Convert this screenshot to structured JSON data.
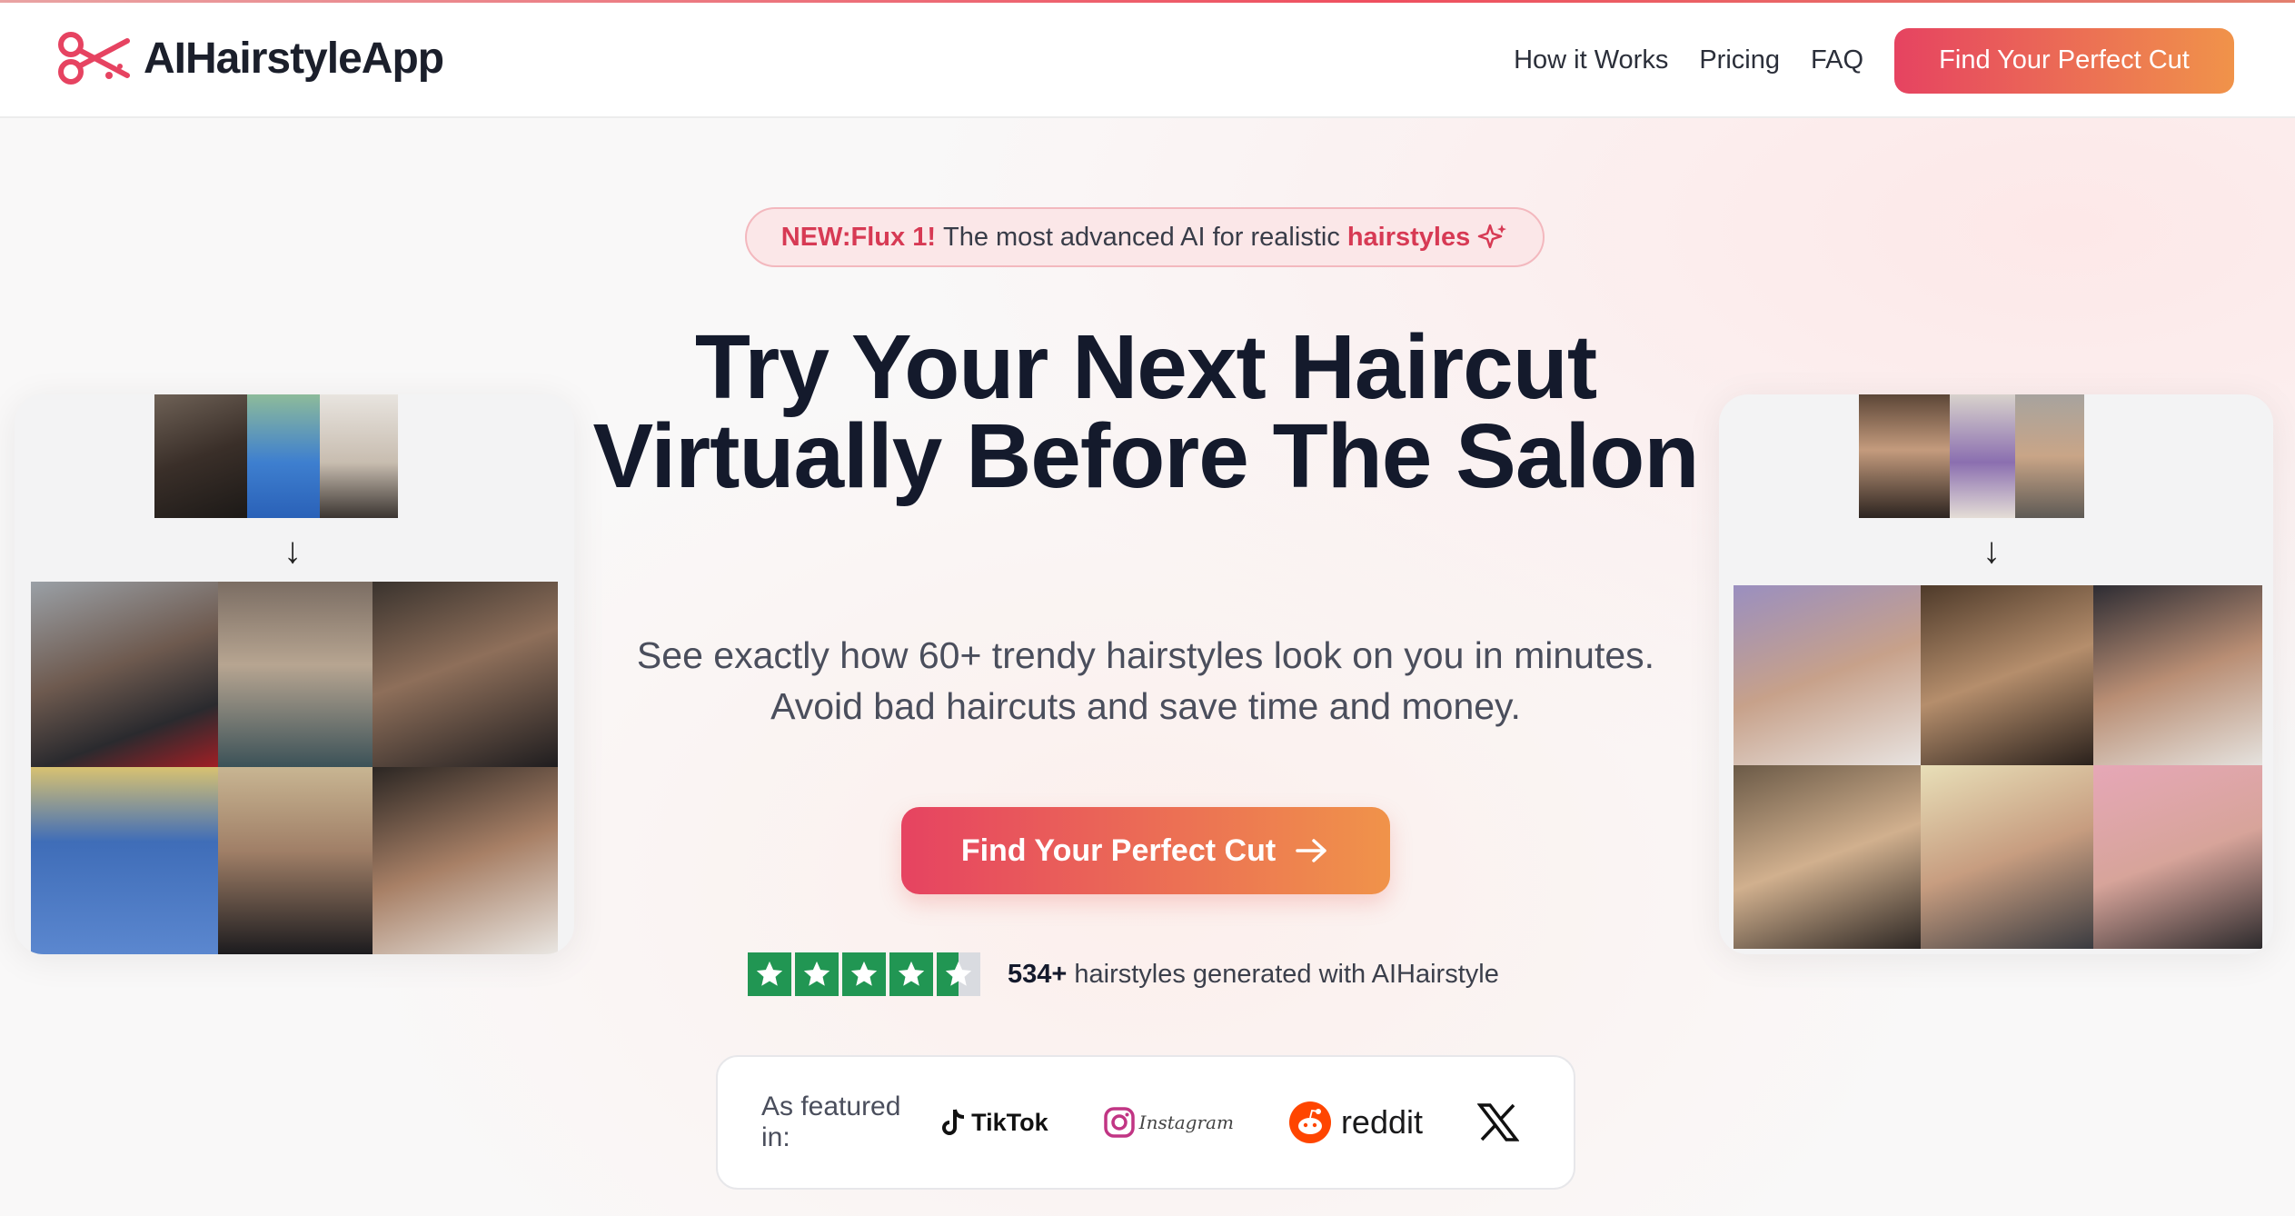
{
  "header": {
    "brand": "AIHairstyleApp",
    "nav": [
      "How it Works",
      "Pricing",
      "FAQ"
    ],
    "cta": "Find Your Perfect Cut"
  },
  "hero": {
    "badge": {
      "new": "NEW:Flux 1!",
      "text": "The most advanced AI for realistic",
      "accent": "hairstyles"
    },
    "headline": "Try Your Next Haircut Virtually Before The Salon",
    "subtitle": "See exactly how 60+ trendy hairstyles look on you in minutes. Avoid bad haircuts and save time and money.",
    "cta": "Find Your Perfect Cut",
    "rating": {
      "stars": 4.5,
      "count": "534+",
      "text": "hairstyles generated with AIHairstyle"
    }
  },
  "featured": {
    "label": "As featured in:",
    "brands": [
      "TikTok",
      "Instagram",
      "reddit",
      "X"
    ]
  },
  "colors": {
    "accent": "#e64361",
    "accent2": "#f0934a",
    "trust_green": "#219653"
  }
}
